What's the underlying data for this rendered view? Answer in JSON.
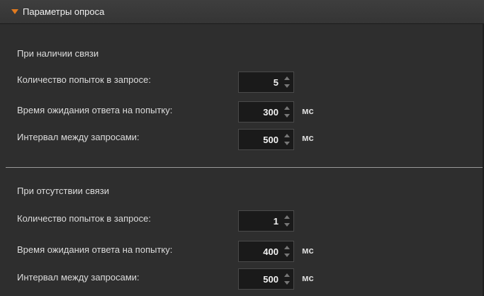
{
  "panel": {
    "title": "Параметры опроса"
  },
  "colors": {
    "accent": "#e07a1f",
    "background": "#2e2e2e",
    "input_background": "#1a1a1a"
  },
  "icons": {
    "collapse": "triangle-down-icon",
    "spin_up": "chevron-up-icon",
    "spin_down": "chevron-down-icon"
  },
  "connected": {
    "title": "При наличии связи",
    "retries_label": "Количество попыток в запросе:",
    "retries_value": "5",
    "timeout_label": "Время ожидания ответа на попытку:",
    "timeout_value": "300",
    "timeout_unit": "мс",
    "interval_label": "Интервал между запросами:",
    "interval_value": "500",
    "interval_unit": "мс"
  },
  "disconnected": {
    "title": "При отсутствии связи",
    "retries_label": "Количество попыток в запросе:",
    "retries_value": "1",
    "timeout_label": "Время ожидания ответа на попытку:",
    "timeout_value": "400",
    "timeout_unit": "мс",
    "interval_label": "Интервал между запросами:",
    "interval_value": "500",
    "interval_unit": "мс"
  }
}
